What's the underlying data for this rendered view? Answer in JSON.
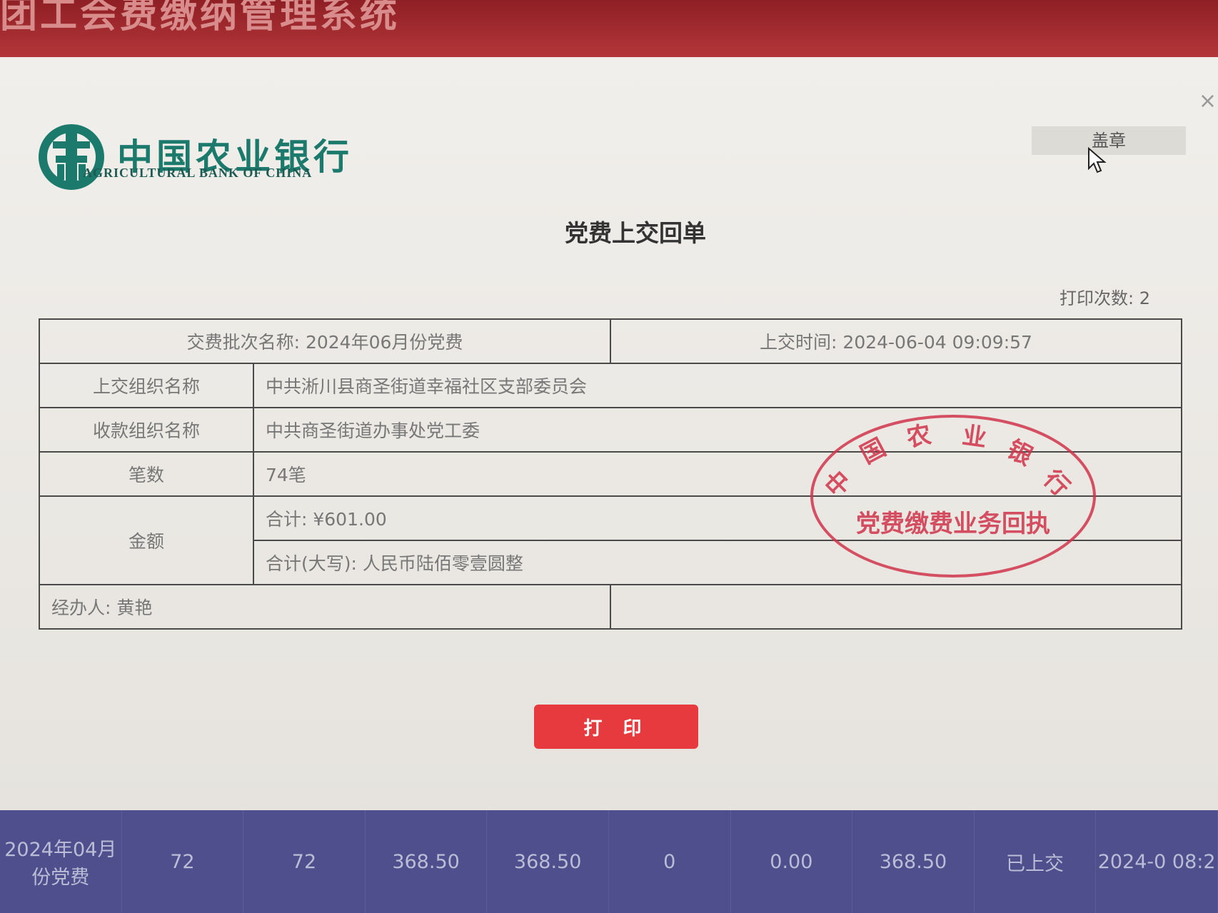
{
  "app": {
    "title": "团工会费缴纳管理系统"
  },
  "dialog": {
    "close_icon": "close-icon",
    "bank_logo": {
      "cn_name": "中国农业银行",
      "en_name": "AGRICULTURAL BANK OF CHINA",
      "color": "#1c7a6c"
    },
    "seal_button_label": "盖章",
    "title": "党费上交回单",
    "print_count": "打印次数: 2",
    "receipt": {
      "batch_name": "交费批次名称: 2024年06月份党费",
      "submit_time": "上交时间: 2024-06-04 09:09:57",
      "submitting_org_label": "上交组织名称",
      "submitting_org_value": "中共淅川县商圣街道幸福社区支部委员会",
      "receiving_org_label": "收款组织名称",
      "receiving_org_value": "中共商圣街道办事处党工委",
      "count_label": "笔数",
      "count_value": "74笔",
      "amount_label": "金额",
      "total": "合计: ¥601.00",
      "total_uppercase": "合计(大写): 人民币陆佰零壹圆整",
      "handler": "经办人: 黄艳"
    },
    "stamp": {
      "top_text": "中国农业银行",
      "bottom_text": "党费缴费业务回执",
      "color": "#d0344a"
    },
    "print_button_label": "打 印",
    "print_button_color": "#e63a3e"
  },
  "background_table": {
    "row": [
      "2024年04月份党费",
      "72",
      "72",
      "368.50",
      "368.50",
      "0",
      "0.00",
      "368.50",
      "已上交",
      "2024-0 08:2"
    ]
  }
}
